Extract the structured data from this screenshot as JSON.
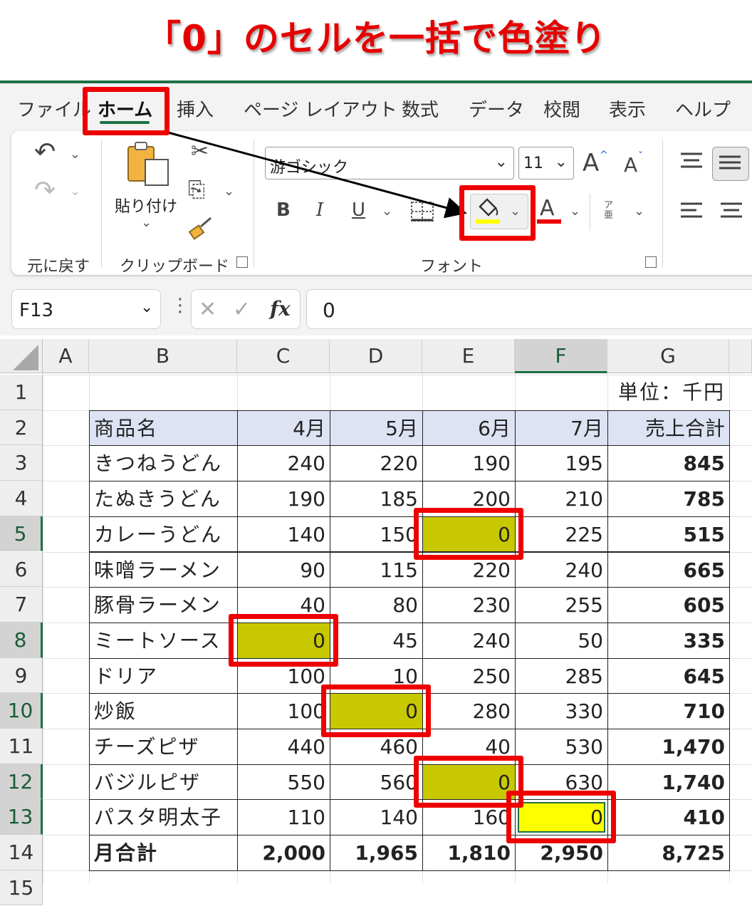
{
  "title": "「0」のセルを一括で色塗り",
  "menu": {
    "tabs": [
      "ファイル",
      "ホーム",
      "挿入",
      "ページ レイアウト",
      "数式",
      "データ",
      "校閲",
      "表示",
      "ヘルプ"
    ],
    "active_tab": "ホーム"
  },
  "ribbon": {
    "undo_group_label": "元に戻す",
    "paste_label": "貼り付け",
    "clipboard_group_label": "クリップボード",
    "font_name": "游ゴシック",
    "font_size": "11",
    "font_group_label": "フォント",
    "bold_label": "B",
    "italic_label": "I",
    "underline_label": "U",
    "font_color_label": "A",
    "grow_font_label": "A",
    "shrink_font_label": "A",
    "phonetic_label": "ア亜",
    "fill_color": "#ffff00",
    "font_color": "#ee0000"
  },
  "formula_bar": {
    "name_box": "F13",
    "fx_label": "fx",
    "value": "0"
  },
  "sheet": {
    "columns": [
      "A",
      "B",
      "C",
      "D",
      "E",
      "F",
      "G"
    ],
    "selected_column": "F",
    "rows": [
      "1",
      "2",
      "3",
      "4",
      "5",
      "6",
      "7",
      "8",
      "9",
      "10",
      "11",
      "12",
      "13",
      "14",
      "15"
    ],
    "selected_rows": [
      "5",
      "8",
      "10",
      "12",
      "13"
    ],
    "unit_note": "単位：千円",
    "header": [
      "商品名",
      "4月",
      "5月",
      "6月",
      "7月",
      "売上合計"
    ],
    "data": [
      [
        "きつねうどん",
        "240",
        "220",
        "190",
        "195",
        "845"
      ],
      [
        "たぬきうどん",
        "190",
        "185",
        "200",
        "210",
        "785"
      ],
      [
        "カレーうどん",
        "140",
        "150",
        "0",
        "225",
        "515"
      ],
      [
        "味噌ラーメン",
        "90",
        "115",
        "220",
        "240",
        "665"
      ],
      [
        "豚骨ラーメン",
        "40",
        "80",
        "230",
        "255",
        "605"
      ],
      [
        "ミートソース",
        "0",
        "45",
        "240",
        "50",
        "335"
      ],
      [
        "ドリア",
        "100",
        "10",
        "250",
        "285",
        "645"
      ],
      [
        "炒飯",
        "100",
        "0",
        "280",
        "330",
        "710"
      ],
      [
        "チーズピザ",
        "440",
        "460",
        "40",
        "530",
        "1,470"
      ],
      [
        "バジルピザ",
        "550",
        "560",
        "0",
        "630",
        "1,740"
      ],
      [
        "パスタ明太子",
        "110",
        "140",
        "160",
        "0",
        "410"
      ]
    ],
    "total_row": [
      "月合計",
      "2,000",
      "1,965",
      "1,810",
      "2,950",
      "8,725"
    ],
    "header_fill": "#dde3f3",
    "zero_fill": "#c8c800",
    "active_fill": "#ffff00"
  },
  "highlight_color": "#ee0000"
}
